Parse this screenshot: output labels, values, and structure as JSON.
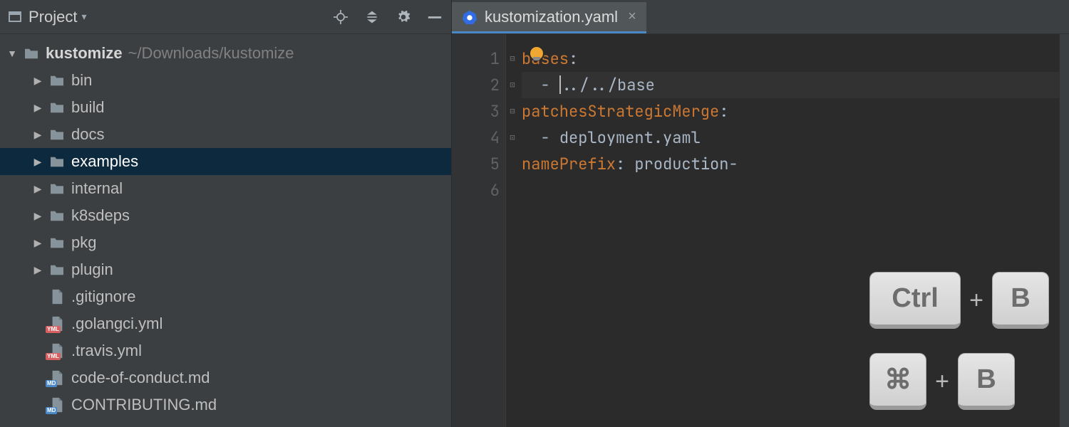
{
  "sidebar": {
    "title": "Project",
    "root": {
      "name": "kustomize",
      "path": "~/Downloads/kustomize"
    },
    "folders": [
      {
        "label": "bin"
      },
      {
        "label": "build"
      },
      {
        "label": "docs"
      },
      {
        "label": "examples",
        "selected": true
      },
      {
        "label": "internal"
      },
      {
        "label": "k8sdeps"
      },
      {
        "label": "pkg"
      },
      {
        "label": "plugin"
      }
    ],
    "files": [
      {
        "label": ".gitignore",
        "badge": ""
      },
      {
        "label": ".golangci.yml",
        "badge": "YML"
      },
      {
        "label": ".travis.yml",
        "badge": "YML"
      },
      {
        "label": "code-of-conduct.md",
        "badge": "MD"
      },
      {
        "label": "CONTRIBUTING.md",
        "badge": "MD"
      }
    ]
  },
  "editor": {
    "tab": {
      "filename": "kustomization.yaml"
    },
    "line_numbers": [
      "1",
      "2",
      "3",
      "4",
      "5",
      "6"
    ],
    "code": {
      "l1": {
        "key": "bases",
        "colon": ":"
      },
      "l2": {
        "dash": "  - ",
        "val": "../../base"
      },
      "l3": {
        "key": "patchesStrategicMerge",
        "colon": ":"
      },
      "l4": {
        "dash": "  - ",
        "val": "deployment.yaml"
      },
      "l5": {
        "key": "namePrefix",
        "colon": ": ",
        "val": "production-"
      }
    }
  },
  "shortcuts": {
    "row1": {
      "k1": "Ctrl",
      "plus": "+",
      "k2": "B"
    },
    "row2": {
      "k1": "⌘",
      "plus": "+",
      "k2": "B"
    }
  }
}
